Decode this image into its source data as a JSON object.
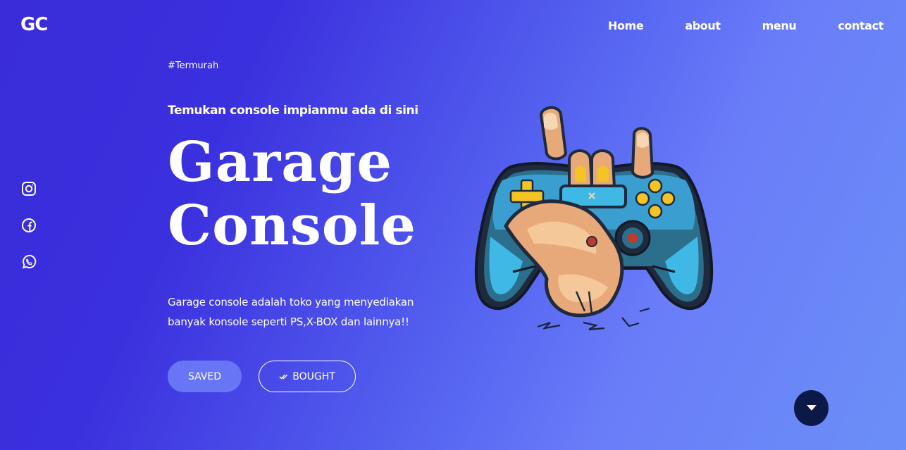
{
  "brand": {
    "logo_text": "GC"
  },
  "nav": {
    "items": [
      {
        "label": "Home"
      },
      {
        "label": "about"
      },
      {
        "label": "menu"
      },
      {
        "label": "contact"
      }
    ]
  },
  "social": {
    "icons": [
      "instagram-icon",
      "facebook-icon",
      "whatsapp-icon"
    ]
  },
  "hero": {
    "tag": "#Termurah",
    "subtitle": "Temukan console impianmu ada di sini",
    "title_line1": "Garage",
    "title_line2": "Console",
    "description": "Garage console adalah toko yang menyediakan banyak konsole seperti PS,X-BOX dan lainnya!!",
    "buttons": {
      "saved_label": "SAVED",
      "bought_label": "BOUGHT"
    }
  },
  "colors": {
    "accent_button": "#6876f6",
    "scroll_button": "#0c1847"
  }
}
